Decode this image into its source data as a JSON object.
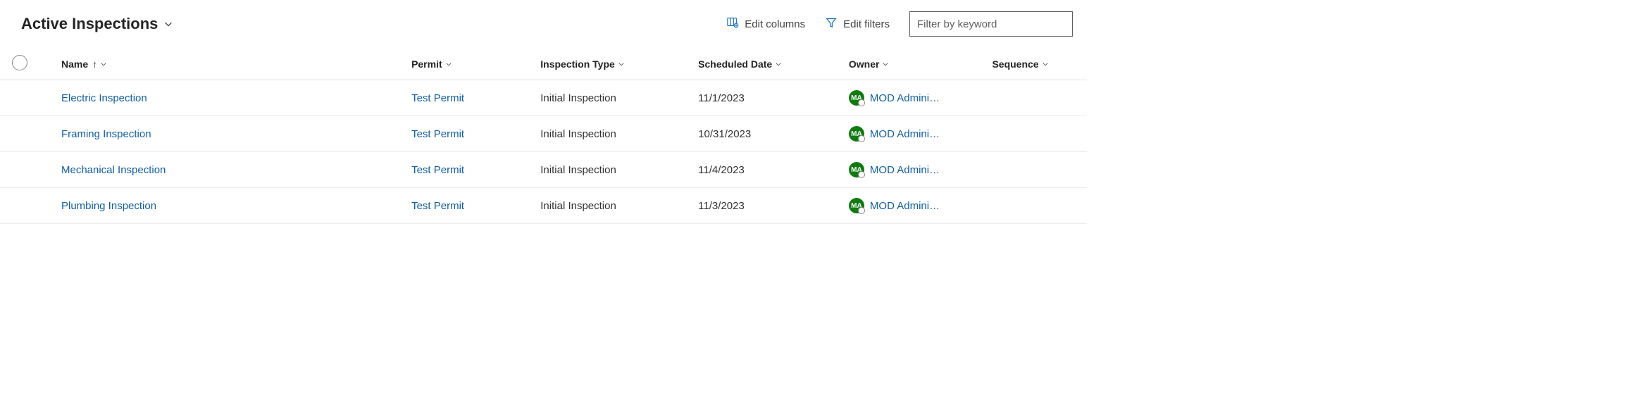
{
  "view": {
    "title": "Active Inspections"
  },
  "toolbar": {
    "edit_columns": "Edit columns",
    "edit_filters": "Edit filters",
    "filter_placeholder": "Filter by keyword"
  },
  "columns": {
    "name": "Name",
    "permit": "Permit",
    "inspection_type": "Inspection Type",
    "scheduled_date": "Scheduled Date",
    "owner": "Owner",
    "sequence": "Sequence"
  },
  "sort": {
    "column": "name",
    "direction": "asc",
    "glyph": "↑"
  },
  "avatar_initials": "MA",
  "rows": [
    {
      "name": "Electric Inspection",
      "permit": "Test Permit",
      "inspection_type": "Initial Inspection",
      "scheduled_date": "11/1/2023",
      "owner": "MOD Admini…",
      "sequence": ""
    },
    {
      "name": "Framing Inspection",
      "permit": "Test Permit",
      "inspection_type": "Initial Inspection",
      "scheduled_date": "10/31/2023",
      "owner": "MOD Admini…",
      "sequence": ""
    },
    {
      "name": "Mechanical Inspection",
      "permit": "Test Permit",
      "inspection_type": "Initial Inspection",
      "scheduled_date": "11/4/2023",
      "owner": "MOD Admini…",
      "sequence": ""
    },
    {
      "name": "Plumbing Inspection",
      "permit": "Test Permit",
      "inspection_type": "Initial Inspection",
      "scheduled_date": "11/3/2023",
      "owner": "MOD Admini…",
      "sequence": ""
    }
  ]
}
